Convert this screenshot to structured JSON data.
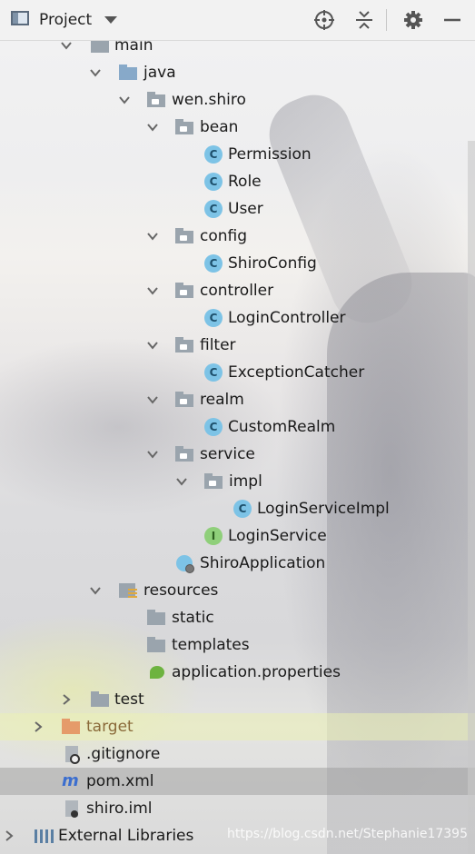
{
  "header": {
    "title": "Project",
    "icons": [
      "locate-icon",
      "collapse-all-icon",
      "gear-icon",
      "minimize-icon"
    ]
  },
  "tree": [
    {
      "label": "main",
      "icon": "folder",
      "expanded": true
    },
    {
      "label": "java",
      "icon": "folder-blue",
      "expanded": true
    },
    {
      "label": "wen.shiro",
      "icon": "package",
      "expanded": true
    },
    {
      "label": "bean",
      "icon": "package",
      "expanded": true
    },
    {
      "label": "Permission",
      "icon": "class"
    },
    {
      "label": "Role",
      "icon": "class"
    },
    {
      "label": "User",
      "icon": "class"
    },
    {
      "label": "config",
      "icon": "package",
      "expanded": true
    },
    {
      "label": "ShiroConfig",
      "icon": "class"
    },
    {
      "label": "controller",
      "icon": "package",
      "expanded": true
    },
    {
      "label": "LoginController",
      "icon": "class"
    },
    {
      "label": "filter",
      "icon": "package",
      "expanded": true
    },
    {
      "label": "ExceptionCatcher",
      "icon": "class"
    },
    {
      "label": "realm",
      "icon": "package",
      "expanded": true
    },
    {
      "label": "CustomRealm",
      "icon": "class"
    },
    {
      "label": "service",
      "icon": "package",
      "expanded": true
    },
    {
      "label": "impl",
      "icon": "package",
      "expanded": true
    },
    {
      "label": "LoginServiceImpl",
      "icon": "class"
    },
    {
      "label": "LoginService",
      "icon": "interface"
    },
    {
      "label": "ShiroApplication",
      "icon": "spring-boot-app"
    },
    {
      "label": "resources",
      "icon": "resources-folder",
      "expanded": true
    },
    {
      "label": "static",
      "icon": "folder"
    },
    {
      "label": "templates",
      "icon": "folder"
    },
    {
      "label": "application.properties",
      "icon": "spring-properties"
    },
    {
      "label": "test",
      "icon": "folder",
      "expanded": false
    },
    {
      "label": "target",
      "icon": "folder-orange",
      "expanded": false
    },
    {
      "label": ".gitignore",
      "icon": "gitignore-file"
    },
    {
      "label": "pom.xml",
      "icon": "maven-file",
      "selected": true
    },
    {
      "label": "shiro.iml",
      "icon": "iml-file"
    },
    {
      "label": "External Libraries",
      "icon": "libraries",
      "expanded": false
    }
  ],
  "watermark": "https://blog.csdn.net/Stephanie17395",
  "colors": {
    "selection": "#9a9a9a",
    "class_icon": "#7dc3e6",
    "interface_icon": "#8fcf7a",
    "target_folder": "#e59b6a"
  }
}
